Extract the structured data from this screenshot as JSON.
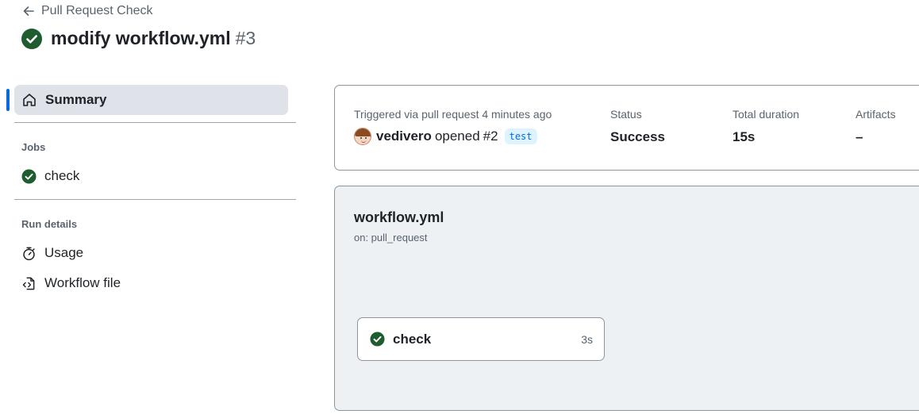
{
  "header": {
    "back_label": "Pull Request Check",
    "title": "modify workflow.yml",
    "run_number": "#3"
  },
  "sidebar": {
    "summary_label": "Summary",
    "jobs_heading": "Jobs",
    "jobs": [
      {
        "label": "check"
      }
    ],
    "run_details_heading": "Run details",
    "run_details": [
      {
        "label": "Usage",
        "icon": "stopwatch-icon"
      },
      {
        "label": "Workflow file",
        "icon": "file-code-icon"
      }
    ]
  },
  "summary_card": {
    "trigger_label": "Triggered via pull request 4 minutes ago",
    "actor": "vedivero",
    "action_text": "opened",
    "pr_ref": "#2",
    "branch": "test",
    "status_label": "Status",
    "status_value": "Success",
    "duration_label": "Total duration",
    "duration_value": "15s",
    "artifacts_label": "Artifacts",
    "artifacts_value": "–"
  },
  "graph": {
    "title": "workflow.yml",
    "subtitle": "on: pull_request",
    "jobs": [
      {
        "name": "check",
        "duration": "3s"
      }
    ]
  },
  "colors": {
    "success": "#1a7f37",
    "accent": "#0969da",
    "selected_bg": "#dfe3e9",
    "graph_bg": "#eef1f4"
  }
}
